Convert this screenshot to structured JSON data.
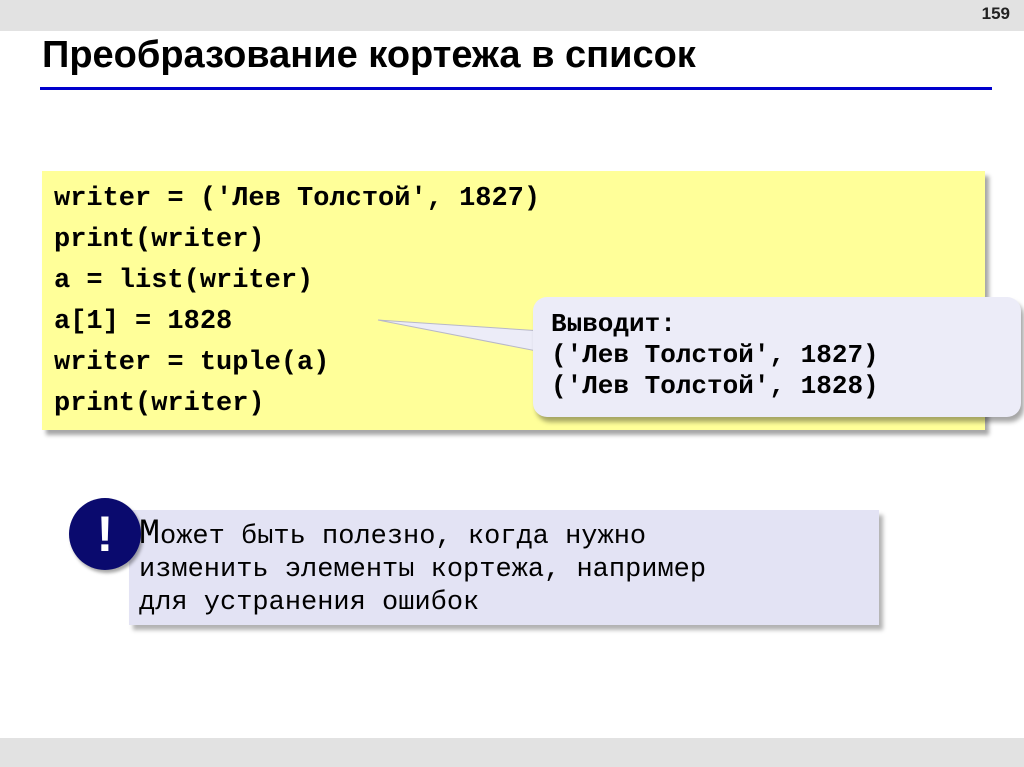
{
  "slide": {
    "page_number": "159",
    "title": "Преобразование кортежа в список"
  },
  "code": {
    "lines": [
      "writer = ('Лев Толстой', 1827)",
      "print(writer)",
      "a = list(writer)",
      "a[1] = 1828",
      "writer = tuple(a)",
      "print(writer)"
    ]
  },
  "callout": {
    "lines": [
      "Выводит:",
      "('Лев Толстой', 1827)",
      "('Лев Толстой', 1828)"
    ]
  },
  "note": {
    "icon_name": "exclamation-icon",
    "icon_symbol": "!",
    "first_letter": "М",
    "line1_rest": "ожет быть полезно, когда нужно",
    "line2": "изменить элементы кортежа, например",
    "line3": "для устранения ошибок"
  },
  "colors": {
    "title_rule": "#0000cc",
    "code_background": "#ffff99",
    "callout_background": "#ececf8",
    "note_background": "#e3e3f4",
    "icon_background": "#0a0a6e"
  }
}
